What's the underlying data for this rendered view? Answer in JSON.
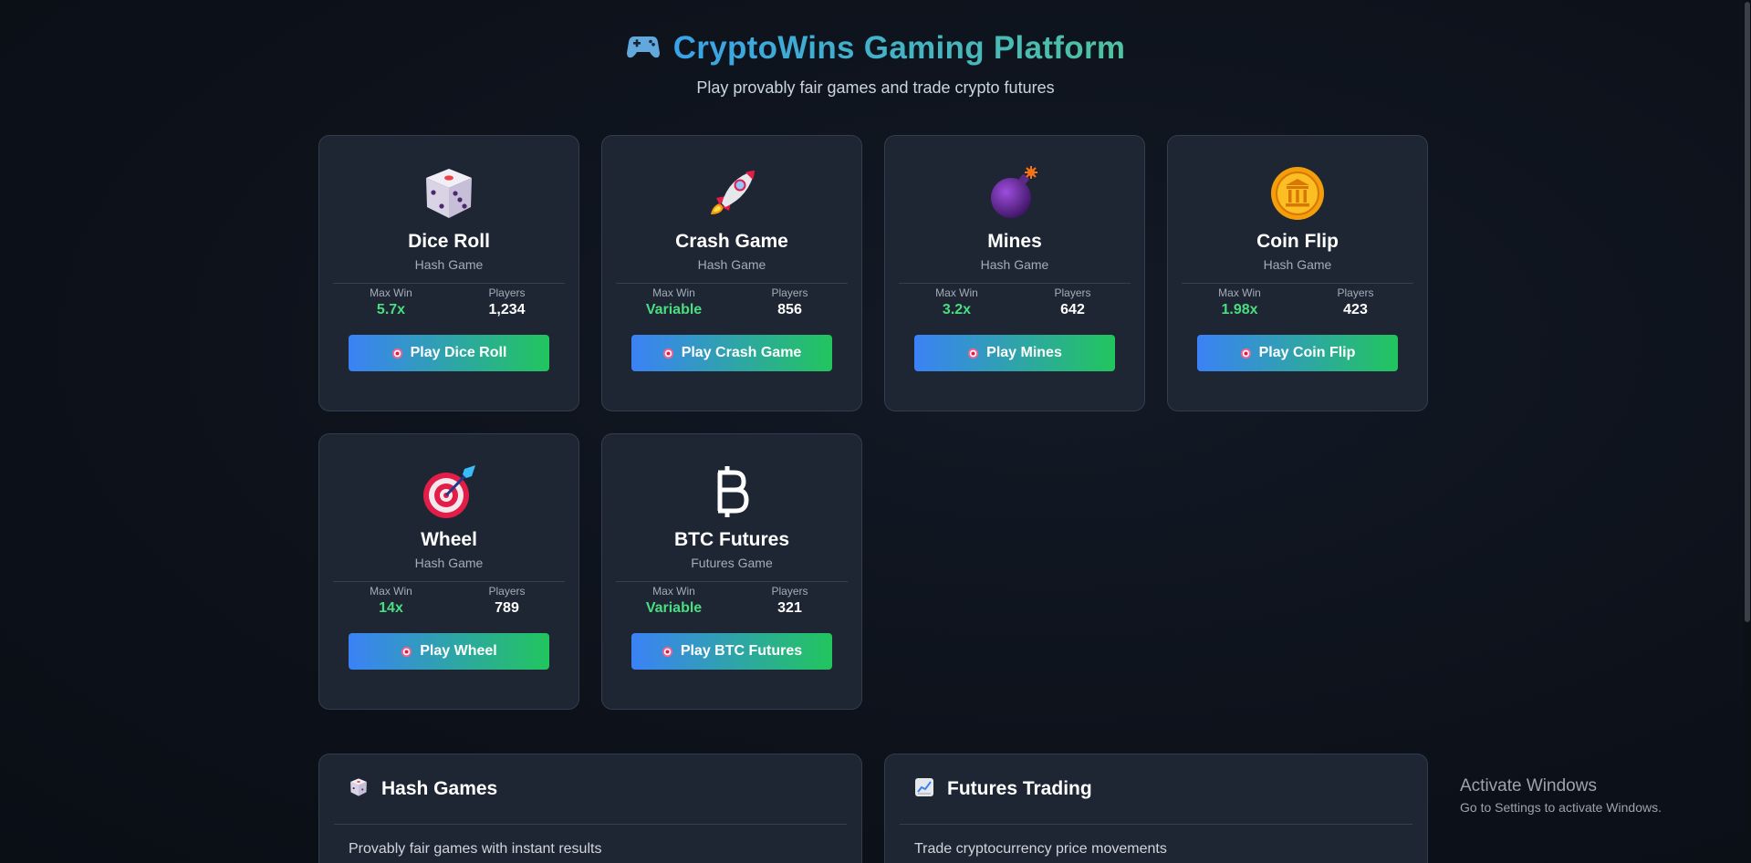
{
  "header": {
    "title": "CryptoWins Gaming Platform",
    "subtitle": "Play provably fair games and trade crypto futures",
    "icon": "gamepad-icon"
  },
  "games": [
    {
      "name": "Dice Roll",
      "type": "Hash Game",
      "icon": "dice-icon",
      "max_win_label": "Max Win",
      "max_win": "5.7x",
      "players_label": "Players",
      "players": "1,234",
      "button": "Play Dice Roll"
    },
    {
      "name": "Crash Game",
      "type": "Hash Game",
      "icon": "rocket-icon",
      "max_win_label": "Max Win",
      "max_win": "Variable",
      "players_label": "Players",
      "players": "856",
      "button": "Play Crash Game"
    },
    {
      "name": "Mines",
      "type": "Hash Game",
      "icon": "bomb-icon",
      "max_win_label": "Max Win",
      "max_win": "3.2x",
      "players_label": "Players",
      "players": "642",
      "button": "Play Mines"
    },
    {
      "name": "Coin Flip",
      "type": "Hash Game",
      "icon": "coin-icon",
      "max_win_label": "Max Win",
      "max_win": "1.98x",
      "players_label": "Players",
      "players": "423",
      "button": "Play Coin Flip"
    },
    {
      "name": "Wheel",
      "type": "Hash Game",
      "icon": "target-icon",
      "max_win_label": "Max Win",
      "max_win": "14x",
      "players_label": "Players",
      "players": "789",
      "button": "Play Wheel"
    },
    {
      "name": "BTC Futures",
      "type": "Futures Game",
      "icon": "bitcoin-icon",
      "max_win_label": "Max Win",
      "max_win": "Variable",
      "players_label": "Players",
      "players": "321",
      "button": "Play BTC Futures"
    }
  ],
  "panels": [
    {
      "title": "Hash Games",
      "icon": "dice-icon",
      "description": "Provably fair games with instant results"
    },
    {
      "title": "Futures Trading",
      "icon": "chart-up-icon",
      "description": "Trade cryptocurrency price movements"
    }
  ],
  "watermark": {
    "title": "Activate Windows",
    "subtitle": "Go to Settings to activate Windows."
  },
  "colors": {
    "background": "#0d121b",
    "card": "#1e2634",
    "accent_blue": "#3b82f6",
    "accent_green": "#22c55e",
    "win_green": "#4ade80"
  }
}
